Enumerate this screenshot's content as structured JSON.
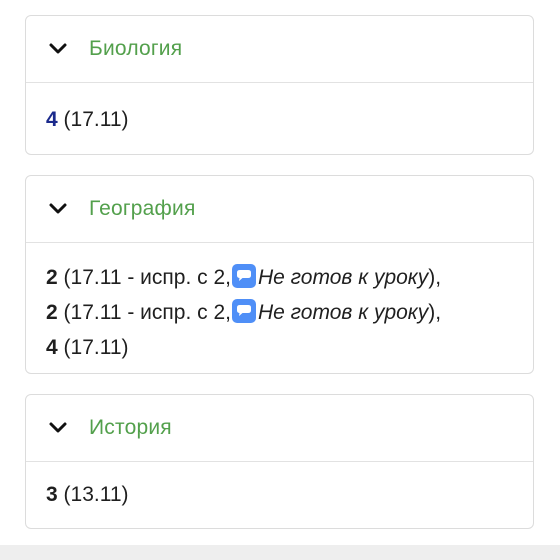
{
  "cards": [
    {
      "subject": "Биология",
      "marks": [
        {
          "grade": "4",
          "date": "(17.11)"
        }
      ]
    },
    {
      "subject": "География",
      "marks": [
        {
          "grade": "2",
          "text": "(17.11 - испр. с 2,",
          "comment": "Не готов к уроку",
          "close": "),",
          "icon": "comment-icon"
        },
        {
          "grade": "2",
          "text": "(17.11 - испр. с 2,",
          "comment": "Не готов к уроку",
          "close": "),",
          "icon": "comment-icon"
        },
        {
          "grade": "4",
          "date": "(17.11)"
        }
      ]
    },
    {
      "subject": "История",
      "marks": [
        {
          "grade": "3",
          "date": "(13.11)"
        }
      ]
    }
  ],
  "icons": {
    "chevron": "chevron-down-icon",
    "comment": "speech-bubble-icon"
  },
  "colors": {
    "subject": "#53a04c",
    "grade_highlight": "#1b2a8c",
    "comment_icon": "#4f8ff7"
  }
}
